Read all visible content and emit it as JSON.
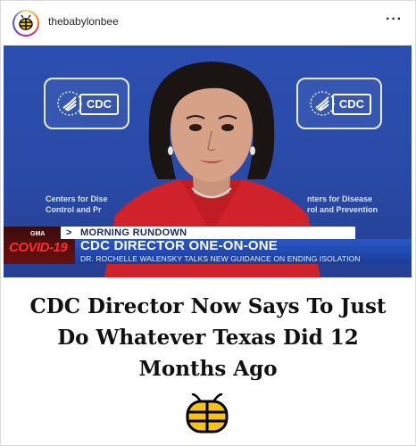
{
  "post": {
    "username": "thebabylonbee",
    "more_icon": "more-horizontal-icon"
  },
  "photo": {
    "cdc_logo_text": "CDC",
    "caption_left_line1": "Centers for Dise",
    "caption_left_line2": "Control and Pr",
    "caption_right_line1": "nters for Disease",
    "caption_right_line2": "rol and Prevention",
    "lower_third": {
      "network": "GMA",
      "tag": "COVID-19",
      "segment": "MORNING RUNDOWN",
      "headline": "CDC DIRECTOR ONE-ON-ONE",
      "subheadline": "DR. ROCHELLE WALENSKY TALKS NEW GUIDANCE ON ENDING ISOLATION"
    }
  },
  "headline": "CDC Director Now Says To Just Do Whatever Texas Did 12 Months Ago",
  "colors": {
    "backdrop_blue": "#2b4fb1",
    "lower_third_blue": "#1b3c9a",
    "covid_red": "#ff2b2b",
    "bee_yellow": "#f4c21b"
  }
}
